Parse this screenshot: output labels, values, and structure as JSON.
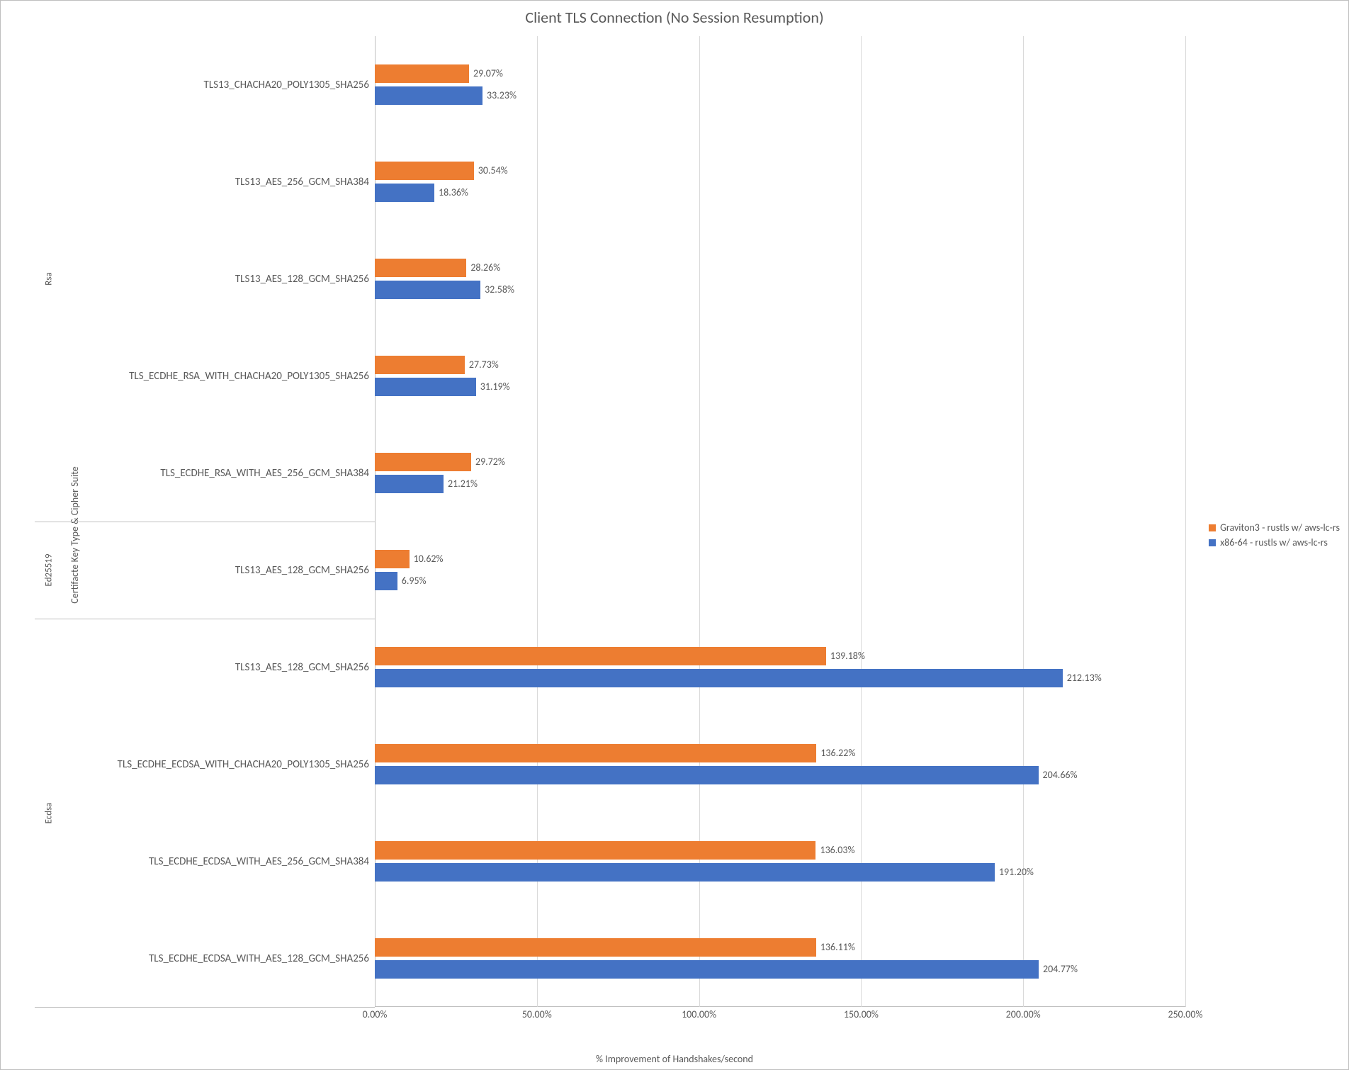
{
  "chart_data": {
    "type": "bar",
    "orientation": "horizontal",
    "title": "Client TLS Connection (No Session Resumption)",
    "xlabel": "% Improvement of Handshakes/second",
    "ylabel": "Certifacte Key Type & Cipher Suite",
    "xlim": [
      0,
      250
    ],
    "xticks": [
      0,
      50,
      100,
      150,
      200,
      250
    ],
    "xtick_labels": [
      "0.00%",
      "50.00%",
      "100.00%",
      "150.00%",
      "200.00%",
      "250.00%"
    ],
    "series_names": [
      "Graviton3 - rustls w/ aws-lc-rs",
      "x86-64 - rustls w/ aws-lc-rs"
    ],
    "series_colors": [
      "#ED7D31",
      "#4472C4"
    ],
    "groups": [
      {
        "name": "Rsa",
        "items": [
          {
            "cipher": "TLS13_CHACHA20_POLY1305_SHA256",
            "values": [
              29.07,
              33.23
            ]
          },
          {
            "cipher": "TLS13_AES_256_GCM_SHA384",
            "values": [
              30.54,
              18.36
            ]
          },
          {
            "cipher": "TLS13_AES_128_GCM_SHA256",
            "values": [
              28.26,
              32.58
            ]
          },
          {
            "cipher": "TLS_ECDHE_RSA_WITH_CHACHA20_POLY1305_SHA256",
            "values": [
              27.73,
              31.19
            ]
          },
          {
            "cipher": "TLS_ECDHE_RSA_WITH_AES_256_GCM_SHA384",
            "values": [
              29.72,
              21.21
            ]
          }
        ]
      },
      {
        "name": "Ed25519",
        "items": [
          {
            "cipher": "TLS13_AES_128_GCM_SHA256",
            "values": [
              10.62,
              6.95
            ]
          }
        ]
      },
      {
        "name": "Ecdsa",
        "items": [
          {
            "cipher": "TLS13_AES_128_GCM_SHA256",
            "values": [
              139.18,
              212.13
            ]
          },
          {
            "cipher": "TLS_ECDHE_ECDSA_WITH_CHACHA20_POLY1305_SHA256",
            "values": [
              136.22,
              204.66
            ]
          },
          {
            "cipher": "TLS_ECDHE_ECDSA_WITH_AES_256_GCM_SHA384",
            "values": [
              136.03,
              191.2
            ]
          },
          {
            "cipher": "TLS_ECDHE_ECDSA_WITH_AES_128_GCM_SHA256",
            "values": [
              136.11,
              204.77
            ]
          }
        ]
      }
    ]
  },
  "legend": {
    "series0": "Graviton3 - rustls w/ aws-lc-rs",
    "series1": "x86-64 - rustls w/ aws-lc-rs"
  }
}
